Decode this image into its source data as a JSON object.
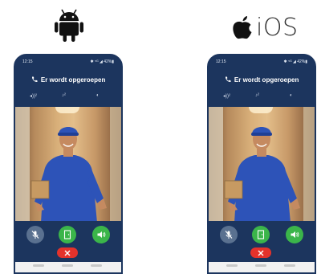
{
  "logos": {
    "android": {
      "icon": "android-icon"
    },
    "ios": {
      "icon": "apple-icon",
      "label": "iOS"
    }
  },
  "phones": [
    {
      "platform": "android",
      "status_time": "12:15",
      "status_right": "✱ ⁵ᴳ ◢ 42%▮",
      "call_title": "Er wordt opgeroepen",
      "controls": [
        "mic-volume-icon",
        "speaker-volume-icon",
        "contrast-icon"
      ],
      "buttons": [
        "mute-button",
        "open-door-button",
        "speaker-button",
        "hangup-button"
      ]
    },
    {
      "platform": "ios",
      "status_time": "12:15",
      "status_right": "✱ ⁵ᴳ ◢ 42%▮",
      "call_title": "Er wordt opgeroepen",
      "controls": [
        "mic-volume-icon",
        "speaker-volume-icon",
        "contrast-icon"
      ],
      "buttons": [
        "mute-button",
        "open-door-button",
        "speaker-button",
        "hangup-button"
      ]
    }
  ],
  "colors": {
    "phone_bg": "#1c355e",
    "accept": "#3bb54a",
    "hangup": "#e4322b",
    "mute": "#5a7190",
    "shirt": "#2d53b8"
  }
}
